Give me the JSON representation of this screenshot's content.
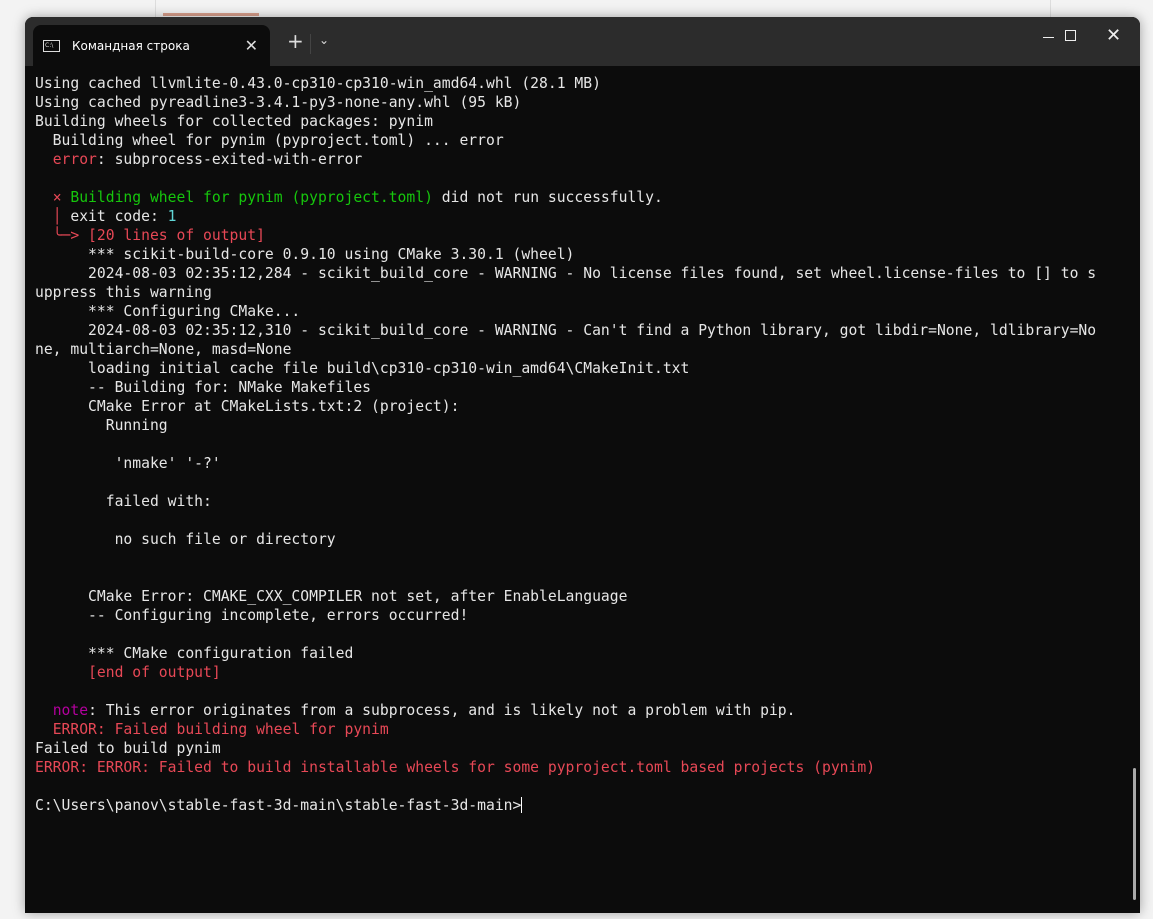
{
  "window": {
    "tab_title": "Командная строка",
    "tab_icon": "cmd-icon",
    "new_tab": "+",
    "dropdown": "⌄"
  },
  "colors": {
    "red": "#e74856",
    "green": "#16c60c",
    "cyan": "#61d6d6",
    "magenta": "#b4009e",
    "text": "#e6e6e6"
  },
  "terminal": {
    "lines": [
      [
        {
          "t": "Using cached llvmlite-0.43.0-cp310-cp310-win_amd64.whl (28.1 MB)"
        }
      ],
      [
        {
          "t": "Using cached pyreadline3-3.4.1-py3-none-any.whl (95 kB)"
        }
      ],
      [
        {
          "t": "Building wheels for collected packages: pynim"
        }
      ],
      [
        {
          "t": "  Building wheel for pynim (pyproject.toml) ... error"
        }
      ],
      [
        {
          "t": "  "
        },
        {
          "t": "error",
          "c": "red"
        },
        {
          "t": ": subprocess-exited-with-error"
        }
      ],
      [
        {
          "t": ""
        }
      ],
      [
        {
          "t": "  "
        },
        {
          "t": "×",
          "c": "red"
        },
        {
          "t": " Building wheel for pynim (pyproject.toml)",
          "c": "green"
        },
        {
          "t": " did not run successfully."
        }
      ],
      [
        {
          "t": "  "
        },
        {
          "t": "│",
          "c": "red"
        },
        {
          "t": " exit code: "
        },
        {
          "t": "1",
          "c": "cyan"
        }
      ],
      [
        {
          "t": "  "
        },
        {
          "t": "╰─>",
          "c": "red"
        },
        {
          "t": " [20 lines of output]",
          "c": "red"
        }
      ],
      [
        {
          "t": "      *** scikit-build-core 0.9.10 using CMake 3.30.1 (wheel)"
        }
      ],
      [
        {
          "t": "      2024-08-03 02:35:12,284 - scikit_build_core - WARNING - No license files found, set wheel.license-files to [] to s"
        }
      ],
      [
        {
          "t": "uppress this warning"
        }
      ],
      [
        {
          "t": "      *** Configuring CMake..."
        }
      ],
      [
        {
          "t": "      2024-08-03 02:35:12,310 - scikit_build_core - WARNING - Can't find a Python library, got libdir=None, ldlibrary=No"
        }
      ],
      [
        {
          "t": "ne, multiarch=None, masd=None"
        }
      ],
      [
        {
          "t": "      loading initial cache file build\\cp310-cp310-win_amd64\\CMakeInit.txt"
        }
      ],
      [
        {
          "t": "      -- Building for: NMake Makefiles"
        }
      ],
      [
        {
          "t": "      CMake Error at CMakeLists.txt:2 (project):"
        }
      ],
      [
        {
          "t": "        Running"
        }
      ],
      [
        {
          "t": ""
        }
      ],
      [
        {
          "t": "         'nmake' '-?'"
        }
      ],
      [
        {
          "t": ""
        }
      ],
      [
        {
          "t": "        failed with:"
        }
      ],
      [
        {
          "t": ""
        }
      ],
      [
        {
          "t": "         no such file or directory"
        }
      ],
      [
        {
          "t": ""
        }
      ],
      [
        {
          "t": ""
        }
      ],
      [
        {
          "t": "      CMake Error: CMAKE_CXX_COMPILER not set, after EnableLanguage"
        }
      ],
      [
        {
          "t": "      -- Configuring incomplete, errors occurred!"
        }
      ],
      [
        {
          "t": ""
        }
      ],
      [
        {
          "t": "      *** CMake configuration failed"
        }
      ],
      [
        {
          "t": "      "
        },
        {
          "t": "[end of output]",
          "c": "red"
        }
      ],
      [
        {
          "t": ""
        }
      ],
      [
        {
          "t": "  "
        },
        {
          "t": "note",
          "c": "mag"
        },
        {
          "t": ": This error originates from a subprocess, and is likely not a problem with pip."
        }
      ],
      [
        {
          "t": "  "
        },
        {
          "t": "ERROR: Failed building wheel for pynim",
          "c": "red"
        }
      ],
      [
        {
          "t": "Failed to build pynim"
        }
      ],
      [
        {
          "t": "ERROR: ERROR: Failed to build installable wheels for some pyproject.toml based projects (pynim)",
          "c": "red"
        }
      ],
      [
        {
          "t": ""
        }
      ],
      [
        {
          "t": "C:\\Users\\panov\\stable-fast-3d-main\\stable-fast-3d-main>"
        }
      ]
    ]
  }
}
